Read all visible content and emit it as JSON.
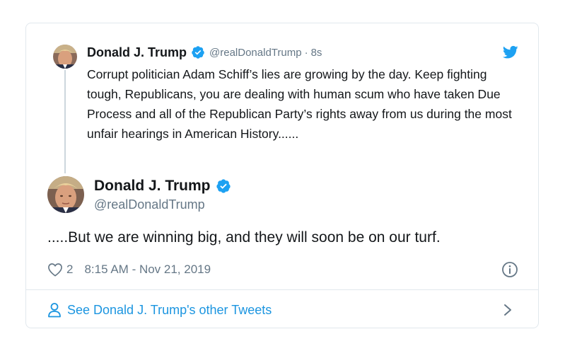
{
  "parent_tweet": {
    "author_name": "Donald J. Trump",
    "handle": "@realDonaldTrump",
    "separator": "·",
    "time": "8s",
    "text": "Corrupt politician Adam Schiff’s lies are growing by the day. Keep fighting tough, Republicans, you are dealing with human scum who have taken Due Process and all of the Republican Party’s rights away from us during the most unfair hearings in American History......",
    "avatar_icon": "avatar",
    "verified_icon": "verified-badge-icon"
  },
  "main_tweet": {
    "author_name": "Donald J. Trump",
    "handle": "@realDonaldTrump",
    "text": ".....But we are winning big, and they will soon be on our turf.",
    "like_count": "2",
    "timestamp": "8:15 AM - Nov 21, 2019",
    "avatar_icon": "avatar",
    "verified_icon": "verified-badge-icon"
  },
  "footer": {
    "link_label": "See Donald J. Trump's other Tweets",
    "person_icon": "person-icon",
    "chevron_icon": "chevron-right-icon"
  },
  "icons": {
    "brand": "twitter-bird-icon",
    "like": "heart-icon",
    "info": "info-icon"
  },
  "colors": {
    "accent": "#1da1f2",
    "link": "#1b95e0",
    "secondary_text": "#657786",
    "border": "#e1e8ed",
    "verified": "#1da1f2"
  }
}
